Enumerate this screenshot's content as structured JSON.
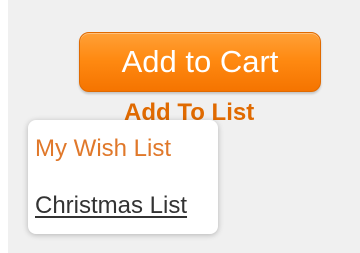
{
  "buttons": {
    "add_to_cart_label": "Add to Cart",
    "add_to_list_label": "Add To List"
  },
  "list_dropdown": {
    "items": [
      {
        "label": "My Wish List"
      },
      {
        "label": "Christmas List"
      }
    ]
  },
  "colors": {
    "accent": "#ff8a12",
    "link_orange": "#e06a00",
    "panel_background": "#f0f0f0"
  }
}
